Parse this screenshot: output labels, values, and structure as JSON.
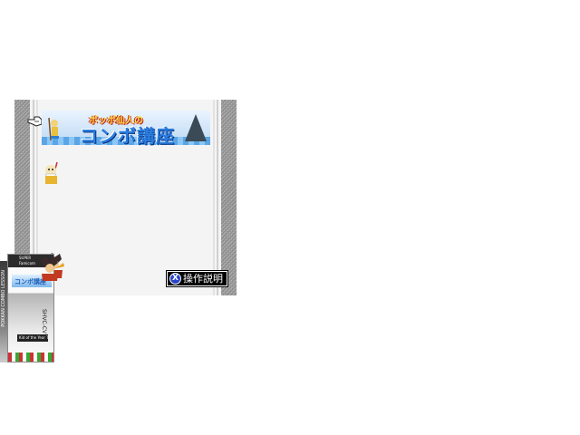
{
  "game": {
    "title_small": "ボッボ仙人の",
    "title_main": "コンボ講座",
    "help_button_label": "操作説明",
    "help_button_glyph": "X"
  },
  "box_art": {
    "brand_line1": "SUPER",
    "brand_line2": "Famicom",
    "title": "コンボ講座",
    "spine_text": "POKKAN COMBO LESSON",
    "side_text": "SHVC-CV",
    "label": "Kid of the Year Tour 1"
  },
  "colors": {
    "wall": "#9a9a9a",
    "background": "#f4f4f4",
    "title_blue": "#2a7ee0",
    "title_yellow": "#ffe24a",
    "button_bg": "#000000",
    "button_glyph": "#2a46c8"
  }
}
